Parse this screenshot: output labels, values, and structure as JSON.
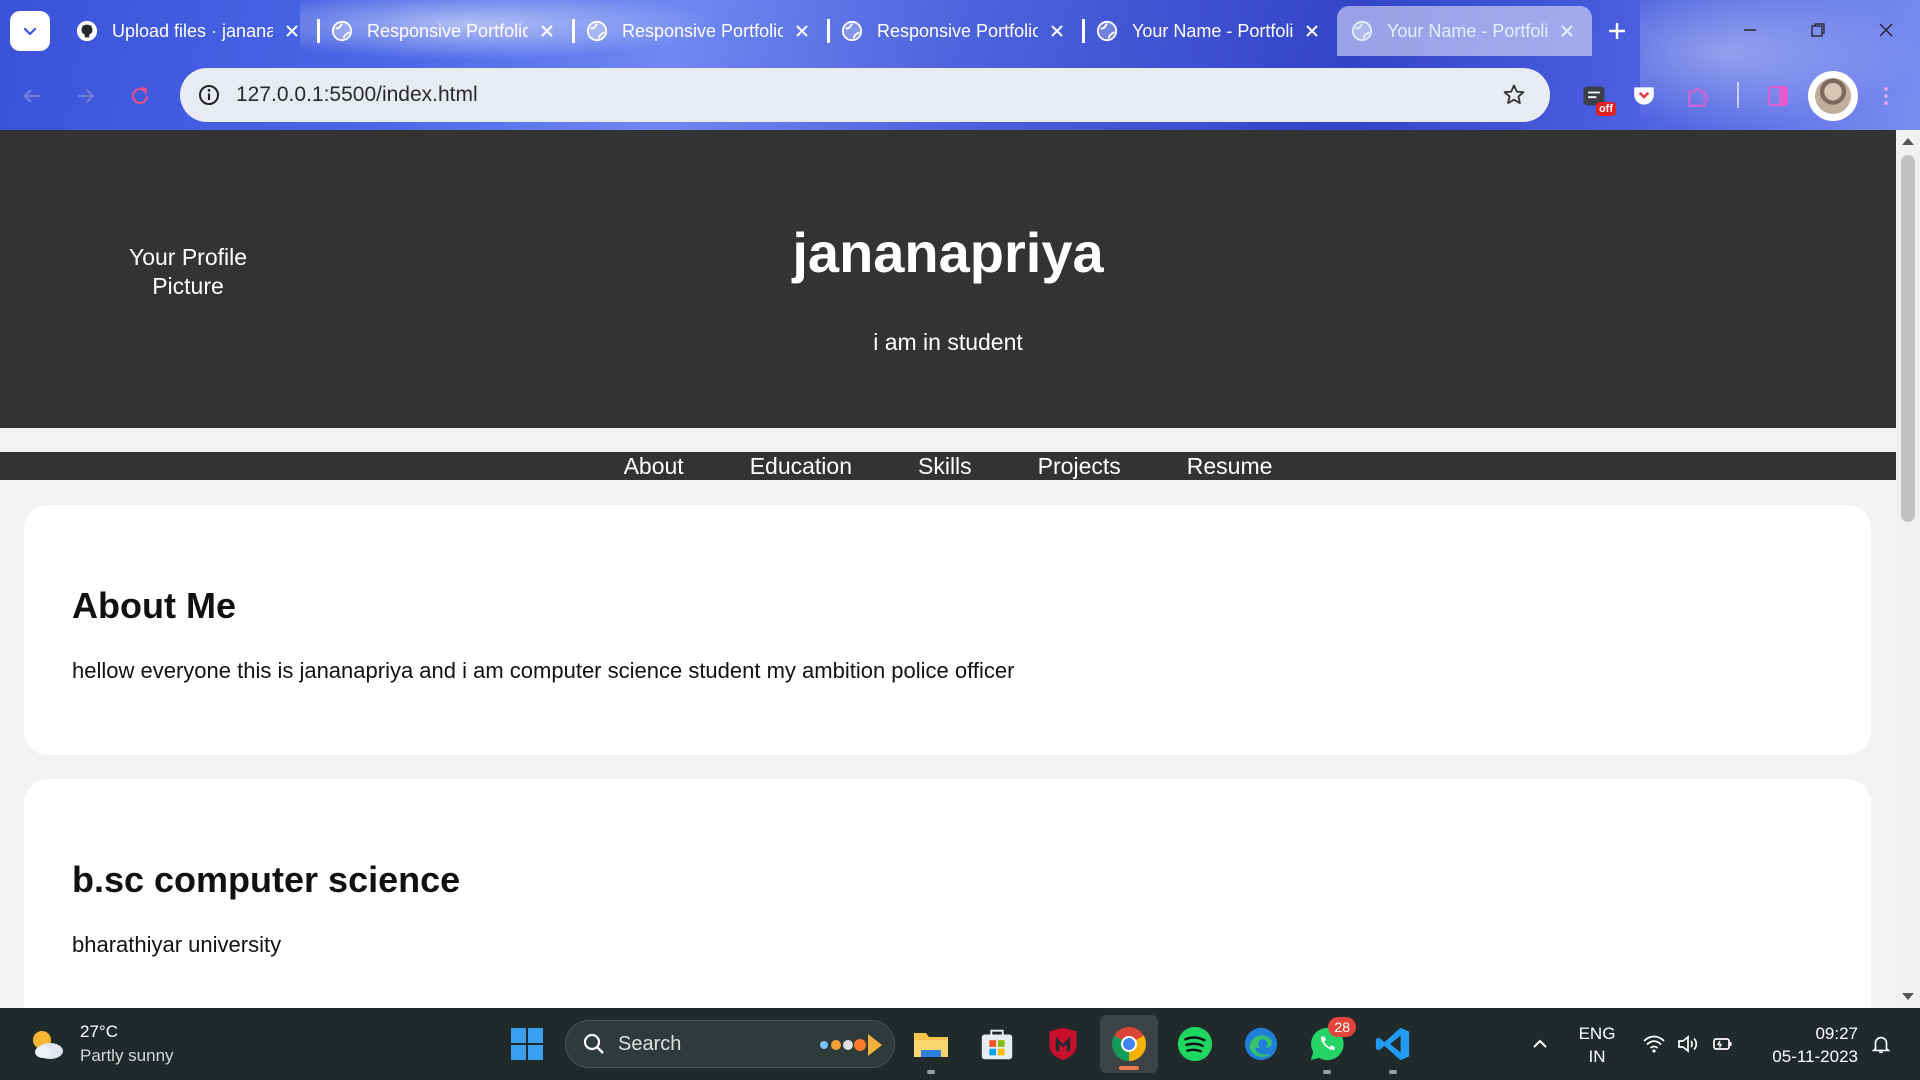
{
  "browser": {
    "tabs": [
      {
        "title": "Upload files · jananapriya",
        "favicon": "github-icon",
        "active": false
      },
      {
        "title": "Responsive Portfolio",
        "favicon": "globe-icon",
        "active": false
      },
      {
        "title": "Responsive Portfolio",
        "favicon": "globe-icon",
        "active": false
      },
      {
        "title": "Responsive Portfolio",
        "favicon": "globe-icon",
        "active": false
      },
      {
        "title": "Your Name - Portfolio",
        "favicon": "globe-icon",
        "active": false
      },
      {
        "title": "Your Name - Portfolio",
        "favicon": "globe-icon",
        "active": true
      }
    ],
    "url": "127.0.0.1:5500/index.html",
    "extension_badge": "off",
    "colors": {
      "accent": "#4a66e6",
      "omnibox": "#e9ebf3"
    }
  },
  "page": {
    "header": {
      "profile_pic_alt_line1": "Your Profile",
      "profile_pic_alt_line2": "Picture",
      "name": "jananapriya",
      "tagline": "i am in student"
    },
    "nav": [
      "About",
      "Education",
      "Skills",
      "Projects",
      "Resume"
    ],
    "about": {
      "heading": "About Me",
      "text": "hellow everyone this is jananapriya and i am computer science student my ambition police officer"
    },
    "education": {
      "heading": "b.sc computer science",
      "text": "bharathiyar university"
    },
    "colors": {
      "header_bg": "#333333",
      "page_bg": "#f2f2f2",
      "card_bg": "#ffffff"
    }
  },
  "taskbar": {
    "weather": {
      "temp": "27°C",
      "condition": "Partly sunny"
    },
    "search_label": "Search",
    "whatsapp_badge": "28",
    "language": {
      "line1": "ENG",
      "line2": "IN"
    },
    "time": "09:27",
    "date": "05-11-2023"
  }
}
